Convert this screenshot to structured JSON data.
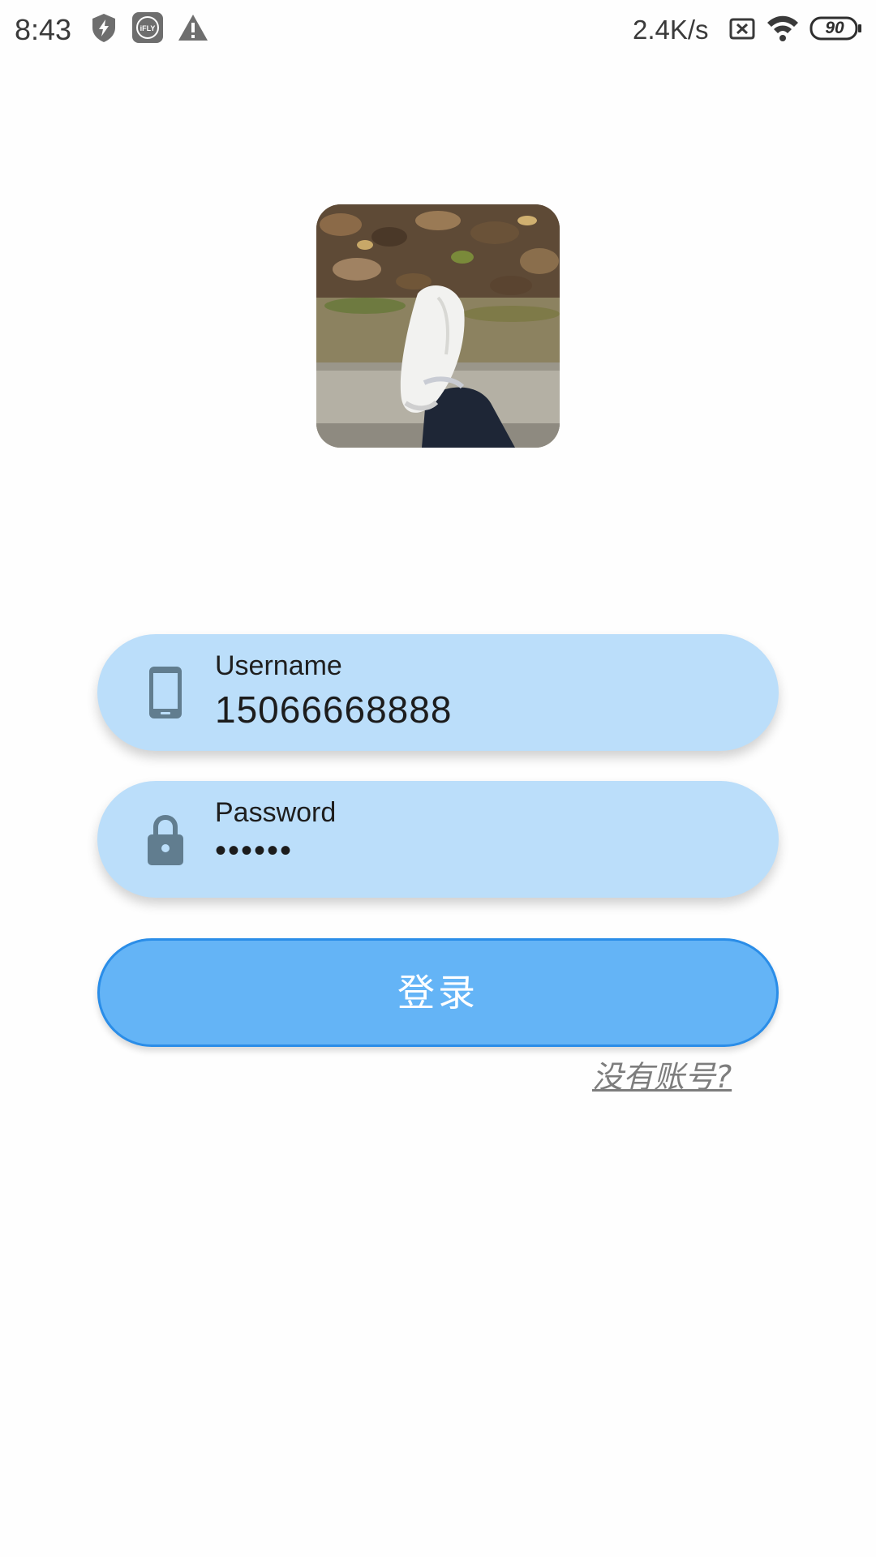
{
  "status_bar": {
    "time": "8:43",
    "icons": [
      "shield-bolt-icon",
      "ifly-icon",
      "warning-icon"
    ],
    "net_speed": "2.4K/s",
    "right_icons": [
      "no-sim-icon",
      "wifi-icon"
    ],
    "battery": "90"
  },
  "logo": {
    "icon": "app-logo-photo"
  },
  "username": {
    "label": "Username",
    "value": "15066668888",
    "icon": "phone-icon"
  },
  "password": {
    "label": "Password",
    "value": "••••••",
    "icon": "lock-icon"
  },
  "login": {
    "label": "登录"
  },
  "register": {
    "label": "没有账号?"
  },
  "colors": {
    "field_bg": "#bbdefa",
    "button_bg": "#64b4f6",
    "button_border": "#2a8de8",
    "icon_color": "#617d8f"
  }
}
